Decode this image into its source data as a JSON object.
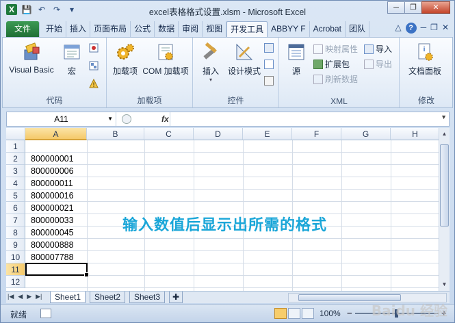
{
  "window": {
    "title": "excel表格格式设置.xlsm - Microsoft Excel",
    "minimize": "─",
    "restore": "❐",
    "close": "✕"
  },
  "qat": {
    "logo": "X",
    "save": "💾",
    "undo": "↶",
    "redo": "↷",
    "customize": "▾"
  },
  "tabs": [
    {
      "label": "文件"
    },
    {
      "label": "开始"
    },
    {
      "label": "插入"
    },
    {
      "label": "页面布局"
    },
    {
      "label": "公式"
    },
    {
      "label": "数据"
    },
    {
      "label": "审阅"
    },
    {
      "label": "视图"
    },
    {
      "label": "开发工具"
    },
    {
      "label": "ABBYY F"
    },
    {
      "label": "Acrobat"
    },
    {
      "label": "团队"
    }
  ],
  "ribbon": {
    "code": {
      "label": "代码",
      "visual_basic": "Visual Basic",
      "macro": "宏"
    },
    "addins": {
      "label": "加载项",
      "addins_btn": "加载项",
      "com_addins": "COM 加载项"
    },
    "controls": {
      "label": "控件",
      "insert": "插入",
      "design_mode": "设计模式"
    },
    "xml": {
      "label": "XML",
      "source": "源",
      "map_props": "映射属性",
      "expansion_packs": "扩展包",
      "refresh": "刷新数据",
      "import": "导入",
      "export": "导出"
    },
    "modify": {
      "label": "修改",
      "doc_panel": "文档面板"
    }
  },
  "formula_bar": {
    "name_box": "A11",
    "fx": "fx",
    "value": ""
  },
  "columns": [
    "A",
    "B",
    "C",
    "D",
    "E",
    "F",
    "G",
    "H"
  ],
  "rows": [
    "1",
    "2",
    "3",
    "4",
    "5",
    "6",
    "7",
    "8",
    "9",
    "10",
    "11",
    "12"
  ],
  "cells": {
    "A2": "800000001",
    "A3": "800000006",
    "A4": "800000011",
    "A5": "800000016",
    "A6": "800000021",
    "A7": "800000033",
    "A8": "800000045",
    "A9": "800000888",
    "A10": "800007788"
  },
  "annotation": "输入数值后显示出所需的格式",
  "sheet_tabs": [
    "Sheet1",
    "Sheet2",
    "Sheet3"
  ],
  "status": {
    "ready": "就绪",
    "zoom": "100%"
  },
  "watermark": "Baidu 经验",
  "colors": {
    "file_tab": "#1f6f35",
    "annotation": "#1aa6d8",
    "selection": "#f5c96a"
  }
}
